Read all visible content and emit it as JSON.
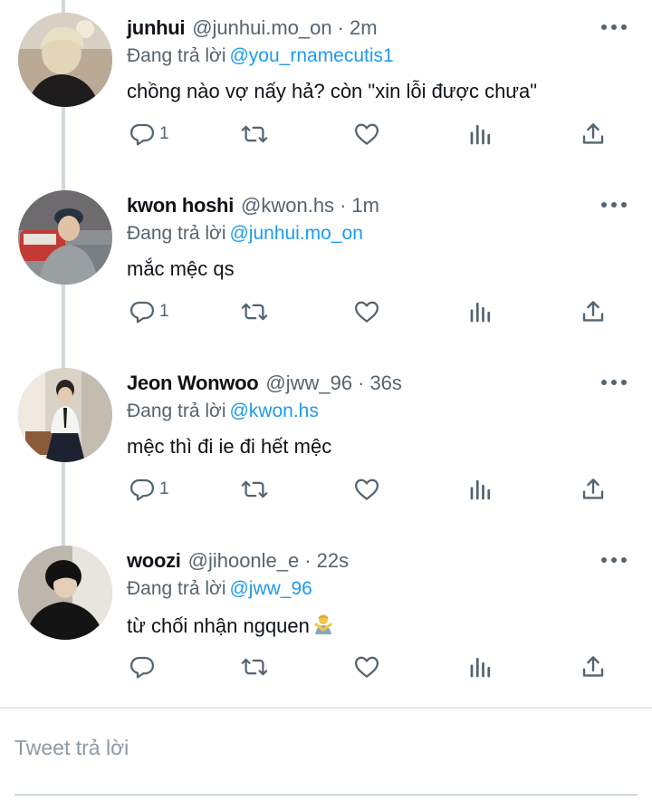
{
  "reply_prefix": "Đang trả lời",
  "compose_placeholder": "Tweet trả lời",
  "colors": {
    "link": "#1d9bf0",
    "muted": "#536471",
    "text": "#0f1419",
    "thread_line": "#cfd9de"
  },
  "icons": {
    "reply": "reply-icon",
    "retweet": "retweet-icon",
    "like": "heart-icon",
    "stats": "stats-icon",
    "share": "share-icon",
    "more": "more-icon"
  },
  "tweets": [
    {
      "name": "junhui",
      "handle": "@junhui.mo_on",
      "separator": "·",
      "time": "2m",
      "reply_to": "@you_rnamecutis1",
      "text": "chồng nào vợ nấy hả? còn \"xin lỗi được chưa\"",
      "reply_count": "1"
    },
    {
      "name": "kwon hoshi",
      "handle": "@kwon.hs",
      "separator": "·",
      "time": "1m",
      "reply_to": "@junhui.mo_on",
      "text": "mắc mệc qs",
      "reply_count": "1"
    },
    {
      "name": "Jeon Wonwoo",
      "handle": "@jww_96",
      "separator": "·",
      "time": "36s",
      "reply_to": "@kwon.hs",
      "text": "mệc thì đi ie đi hết mệc",
      "reply_count": "1"
    },
    {
      "name": "woozi",
      "handle": "@jihoonle_e",
      "separator": "·",
      "time": "22s",
      "reply_to": "@jww_96",
      "text": "từ chối nhận ngquen",
      "reply_count": ""
    }
  ]
}
